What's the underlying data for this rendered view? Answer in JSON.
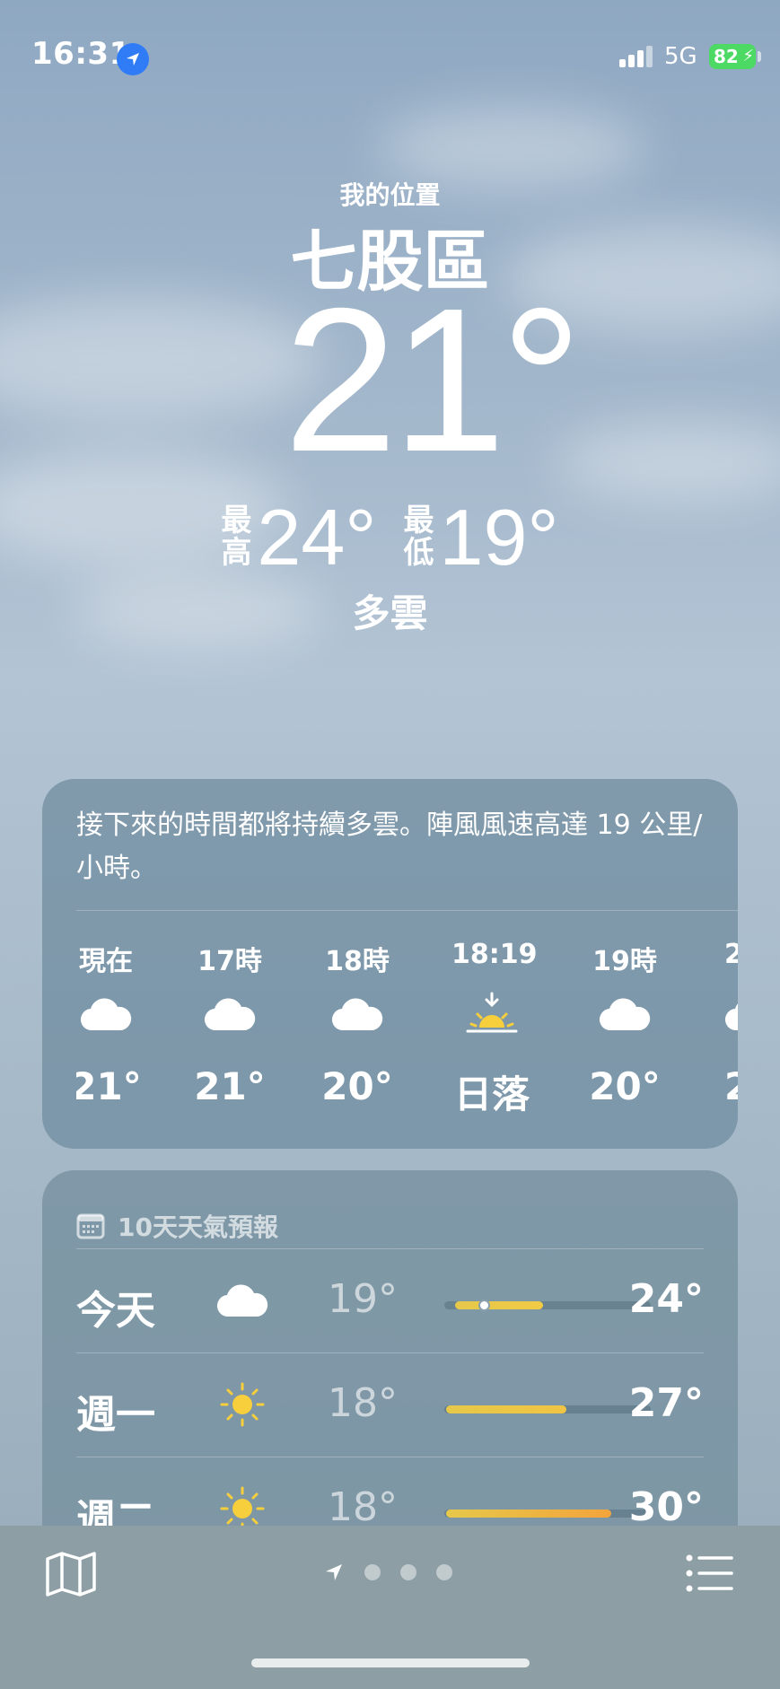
{
  "status_bar": {
    "time": "16:31",
    "network": "5G",
    "battery": "82"
  },
  "header": {
    "location_label": "我的位置",
    "city": "七股區",
    "current_temp": "21°",
    "high_label": "最高",
    "high_value": "24°",
    "low_label": "最低",
    "low_value": "19°",
    "condition": "多雲"
  },
  "hourly": {
    "summary": "接下來的時間都將持續多雲。陣風風速高達 19 公里/小時。",
    "items": [
      {
        "label": "現在",
        "icon": "cloud-icon",
        "temp": "21°"
      },
      {
        "label": "17時",
        "icon": "cloud-icon",
        "temp": "21°"
      },
      {
        "label": "18時",
        "icon": "cloud-icon",
        "temp": "20°"
      },
      {
        "label": "18:19",
        "icon": "sunset-icon",
        "temp": "日落"
      },
      {
        "label": "19時",
        "icon": "cloud-icon",
        "temp": "20°"
      },
      {
        "label": "2",
        "icon": "cloud-icon",
        "temp": "2"
      }
    ]
  },
  "forecast": {
    "title": "10天天氣預報",
    "days": [
      {
        "name": "今天",
        "icon": "cloud-icon",
        "low": "19°",
        "high": "24°"
      },
      {
        "name": "週一",
        "icon": "sun-icon",
        "low": "18°",
        "high": "27°"
      },
      {
        "name": "週二",
        "icon": "sun-icon",
        "low": "18°",
        "high": "30°"
      }
    ]
  },
  "colors": {
    "location_badge": "#2f7cf6",
    "battery": "#4cd964",
    "sun": "#f7cf3c",
    "bar_warm": "#f3a43b",
    "bar_mild": "#e6c84a"
  }
}
